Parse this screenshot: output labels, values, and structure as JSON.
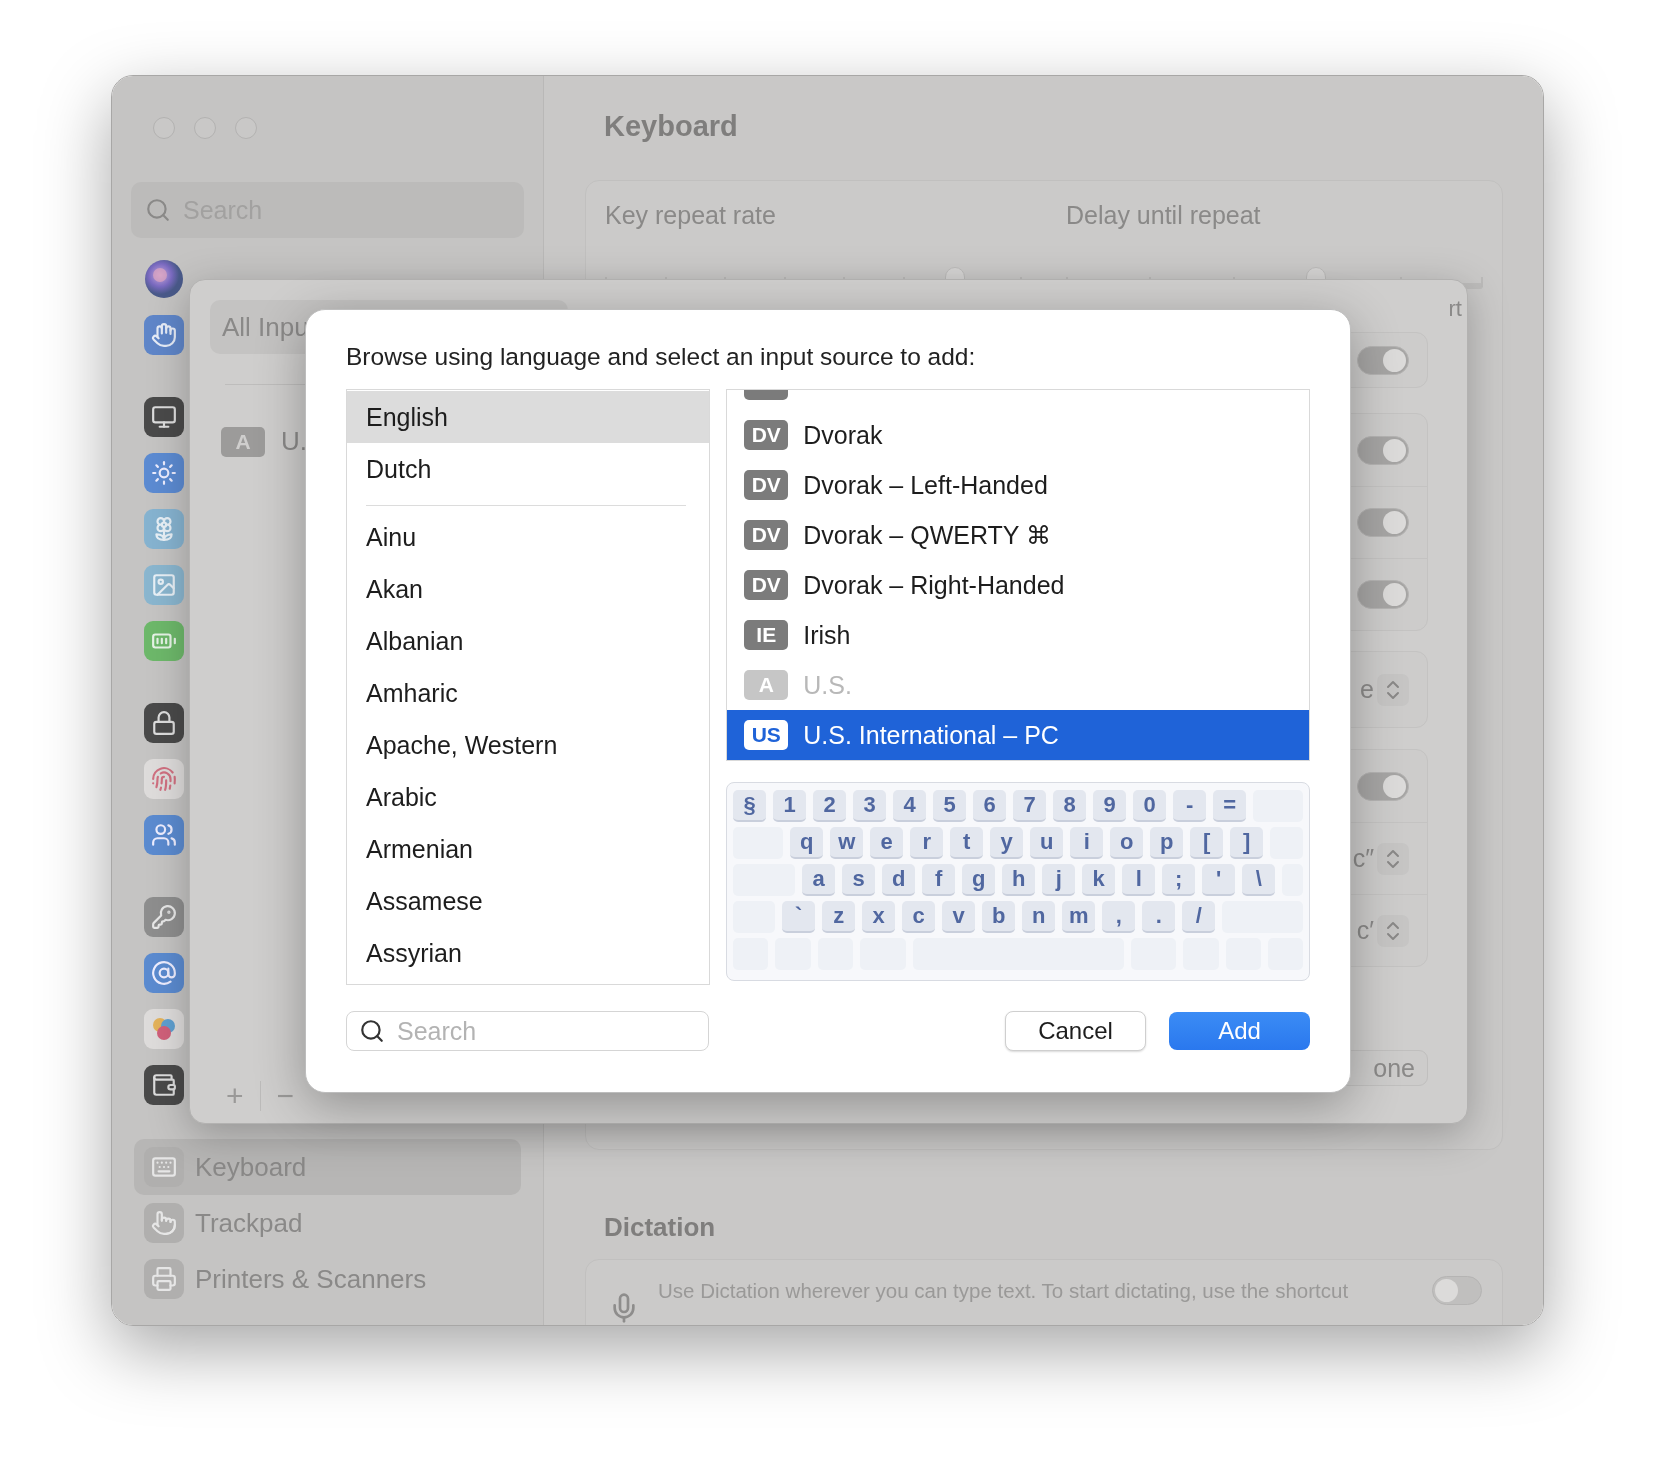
{
  "sidebar": {
    "search": {
      "placeholder": "Search"
    },
    "groups": [
      [
        {
          "kind": "siri",
          "selected": false
        },
        {
          "kind": "hand",
          "selected": false
        }
      ],
      [
        {
          "kind": "display",
          "selected": false
        },
        {
          "kind": "sun",
          "selected": false
        },
        {
          "kind": "flower",
          "selected": false
        },
        {
          "kind": "wallpaper",
          "selected": false
        },
        {
          "kind": "battery",
          "selected": false
        }
      ],
      [
        {
          "kind": "lock",
          "selected": false
        },
        {
          "kind": "fingerprint",
          "selected": false
        },
        {
          "kind": "users",
          "selected": false
        }
      ],
      [
        {
          "kind": "key",
          "selected": false
        },
        {
          "kind": "at",
          "selected": false
        },
        {
          "kind": "colors",
          "selected": false
        },
        {
          "kind": "wallet",
          "selected": false
        }
      ],
      [
        {
          "kind": "keyboard",
          "label": "Keyboard",
          "selected": true
        },
        {
          "kind": "trackpad",
          "label": "Trackpad",
          "selected": false
        },
        {
          "kind": "printer",
          "label": "Printers & Scanners",
          "selected": false
        }
      ]
    ]
  },
  "main": {
    "title": "Keyboard",
    "sliders": [
      {
        "label": "Key repeat rate",
        "level": 0.84
      },
      {
        "label": "Delay until repeat",
        "level": 0.6
      }
    ],
    "dictation": {
      "title": "Dictation",
      "text": "Use Dictation wherever you can type text. To start dictating, use the shortcut",
      "on": false
    }
  },
  "sheet": {
    "segment": "All Inpu",
    "sources": [
      {
        "badge": "A",
        "label": "U."
      }
    ],
    "add": "+",
    "remove": "−",
    "corner_text": "rt",
    "cards": [
      {
        "rows": [
          {
            "kind": "toggle",
            "on": true
          }
        ]
      },
      {
        "rows": [
          {
            "kind": "toggle",
            "on": true
          },
          {
            "kind": "toggle",
            "on": true
          },
          {
            "kind": "toggle",
            "on": true
          }
        ]
      },
      {
        "rows": [
          {
            "kind": "popup",
            "text": "e"
          }
        ]
      },
      {
        "rows": [
          {
            "kind": "toggle",
            "on": true
          },
          {
            "kind": "popup",
            "text": "c″"
          },
          {
            "kind": "popup",
            "text": "c′"
          }
        ]
      }
    ],
    "button": "one"
  },
  "dialog": {
    "prompt": "Browse using language and select an input source to add:",
    "languages": {
      "preferred": [
        {
          "label": "English",
          "selected": true
        },
        {
          "label": "Dutch",
          "selected": false
        }
      ],
      "all": [
        {
          "label": "Ainu",
          "selected": false
        },
        {
          "label": "Akan",
          "selected": false
        },
        {
          "label": "Albanian",
          "selected": false
        },
        {
          "label": "Amharic",
          "selected": false
        },
        {
          "label": "Apache, Western",
          "selected": false
        },
        {
          "label": "Arabic",
          "selected": false
        },
        {
          "label": "Armenian",
          "selected": false
        },
        {
          "label": "Assamese",
          "selected": false
        },
        {
          "label": "Assyrian",
          "selected": false
        }
      ]
    },
    "input_sources": [
      {
        "selected": false
      },
      {
        "badge": "DV",
        "label": "Dvorak",
        "disabled": false,
        "selected": false
      },
      {
        "badge": "DV",
        "label": "Dvorak – Left-Handed",
        "disabled": false,
        "selected": false
      },
      {
        "badge": "DV",
        "label": "Dvorak – QWERTY ⌘",
        "disabled": false,
        "selected": false
      },
      {
        "badge": "DV",
        "label": "Dvorak – Right-Handed",
        "disabled": false,
        "selected": false
      },
      {
        "badge": "IE",
        "label": "Irish",
        "disabled": false,
        "selected": false
      },
      {
        "badge": "A",
        "label": "U.S.",
        "disabled": true,
        "selected": false
      },
      {
        "badge": "US",
        "label": "U.S. International – PC",
        "disabled": false,
        "selected": true
      }
    ],
    "keyboard": {
      "rows": [
        [
          "§",
          "1",
          "2",
          "3",
          "4",
          "5",
          "6",
          "7",
          "8",
          "9",
          "0",
          "-",
          "="
        ],
        [
          "q",
          "w",
          "e",
          "r",
          "t",
          "y",
          "u",
          "i",
          "o",
          "p",
          "[",
          "]"
        ],
        [
          "a",
          "s",
          "d",
          "f",
          "g",
          "h",
          "j",
          "k",
          "l",
          ";",
          "'",
          "\\"
        ],
        [
          "`",
          "z",
          "x",
          "c",
          "v",
          "b",
          "n",
          "m",
          ",",
          ".",
          "/"
        ]
      ]
    },
    "search": {
      "placeholder": "Search"
    },
    "buttons": [
      {
        "label": "Cancel",
        "kind": "secondary"
      },
      {
        "label": "Add",
        "kind": "primary"
      }
    ]
  }
}
